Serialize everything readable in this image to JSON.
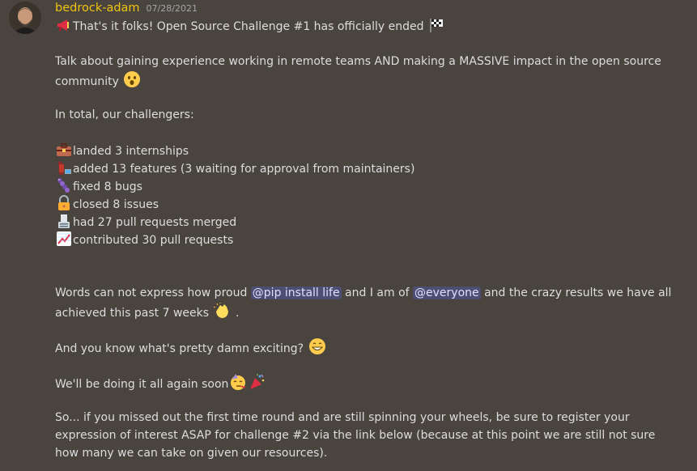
{
  "author": {
    "username": "bedrock-adam",
    "timestamp": "07/28/2021",
    "name_color": "#f1c40f"
  },
  "message": {
    "line1_text": "That's it folks! Open Source Challenge #1 has officially ended",
    "line1_icons": [
      "megaphone-icon",
      "checkered-flag-icon"
    ],
    "para2_text": "Talk about gaining experience working in remote teams AND making a MASSIVE impact in the open source community",
    "para2_icon": "astonished-face-icon",
    "para3_text": "In total, our challengers:",
    "stats": [
      {
        "icon": "briefcase-icon",
        "text": "landed 3 internships"
      },
      {
        "icon": "woman-technologist-icon",
        "text": "added 13 features (3 waiting for approval from maintainers)"
      },
      {
        "icon": "bug-icon",
        "text": "fixed 8 bugs"
      },
      {
        "icon": "lock-icon",
        "text": "closed 8 issues"
      },
      {
        "icon": "merge-icon",
        "text": "had 27 pull requests merged"
      },
      {
        "icon": "chart-increasing-icon",
        "text": "contributed 30 pull requests"
      }
    ],
    "para4_part1": "Words can not express how proud",
    "mention1": "@pip install life",
    "para4_part2": "and I am of",
    "mention2": "@everyone",
    "para4_part3": "and the crazy results we have all",
    "para4_line2": "achieved this past 7 weeks",
    "para4_end": ".",
    "para4_icon": "clapping-hands-icon",
    "para5_text": "And you know what's pretty damn exciting?",
    "para5_icon": "grinning-face-icon",
    "para6_text": "We'll be doing it all again soon",
    "para6_icons": [
      "partying-face-icon",
      "party-popper-icon"
    ],
    "para7_text": "So... if you missed out the first time round and are still spinning your wheels, be sure to register your expression of interest ASAP for challenge #2 via the link below (because at this point we are still not sure how many we can take on given our resources)."
  }
}
